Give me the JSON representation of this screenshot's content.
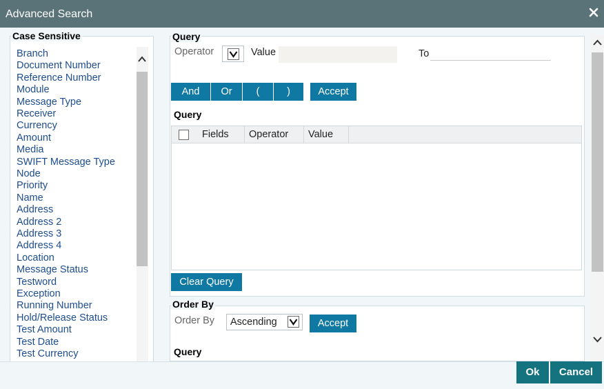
{
  "window": {
    "title": "Advanced Search",
    "close_icon": "close-icon"
  },
  "fields_panel": {
    "legend": "Case Sensitive",
    "items": [
      "Branch",
      "Document Number",
      "Reference Number",
      "Module",
      "Message Type",
      "Receiver",
      "Currency",
      "Amount",
      "Media",
      "SWIFT Message Type",
      "Node",
      "Priority",
      "Name",
      "Address",
      "Address 2",
      "Address 3",
      "Address 4",
      "Location",
      "Message Status",
      "Testword",
      "Exception",
      "Running Number",
      "Hold/Release Status",
      "Test Amount",
      "Test Date",
      "Test Currency"
    ]
  },
  "query_section": {
    "legend": "Query",
    "operator_label": "Operator",
    "value_label": "Value",
    "to_label": "To",
    "value_text": "",
    "to_text": "",
    "buttons": {
      "and": "And",
      "or": "Or",
      "open_paren": "(",
      "close_paren": ")",
      "accept": "Accept"
    },
    "sub_legend": "Query",
    "grid_columns": [
      "Fields",
      "Operator",
      "Value"
    ],
    "clear_query": "Clear Query"
  },
  "order_section": {
    "legend": "Order By",
    "order_by_label": "Order By",
    "order_value": "Ascending",
    "accept": "Accept",
    "sub_legend": "Query"
  },
  "footer": {
    "ok": "Ok",
    "cancel": "Cancel"
  },
  "colors": {
    "titlebar": "#597378",
    "button": "#0f79a4",
    "footer_button": "#14737f",
    "link_text": "#1d4d8f"
  }
}
